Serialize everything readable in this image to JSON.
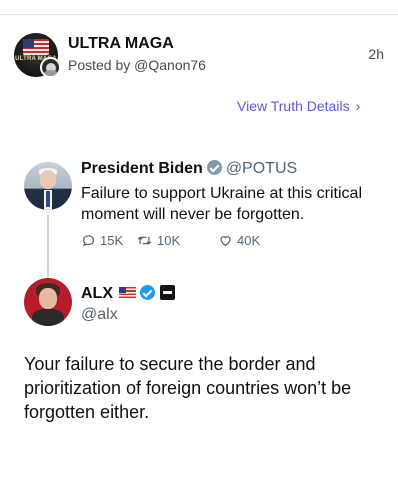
{
  "post": {
    "display_name": "ULTRA MAGA",
    "posted_by": "Posted by @Qanon76",
    "time": "2h",
    "avatar_text": "ULTRA MAGA"
  },
  "details_link": {
    "label": "View Truth Details",
    "chevron": "›"
  },
  "embed": {
    "tweet1": {
      "name": "President Biden",
      "handle": "@POTUS",
      "text": "Failure to support Ukraine at this critical moment will never be forgotten.",
      "replies": "15K",
      "retweets": "10K",
      "likes": "40K"
    },
    "tweet2": {
      "name": "ALX",
      "handle": "@alx",
      "text": "Your failure to secure the border and prioritization of foreign countries won’t be forgotten either."
    }
  },
  "icons": {
    "verified_gray": "verified-gray-badge-icon",
    "verified_blue": "verified-blue-badge-icon",
    "reply": "reply-icon",
    "retweet": "retweet-icon",
    "like": "heart-icon",
    "chevron": "chevron-right-icon"
  },
  "colors": {
    "link": "#5a5ad6",
    "muted": "#536471",
    "verified_blue": "#1d9bf0",
    "verified_gray": "#829aab"
  }
}
